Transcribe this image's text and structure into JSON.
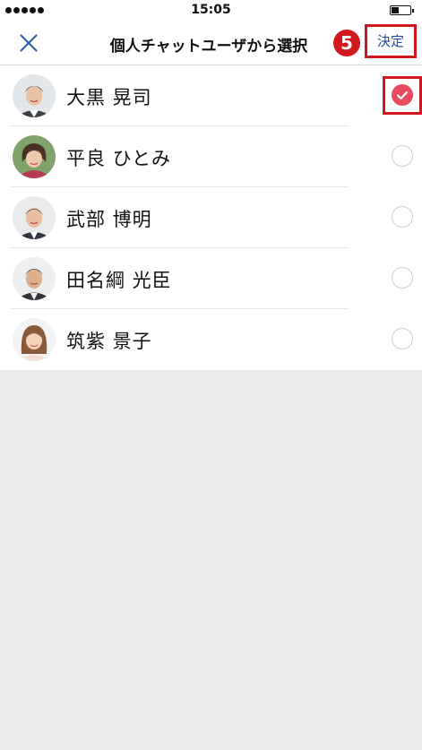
{
  "status_bar": {
    "time": "15:05",
    "battery_level": 0.35
  },
  "navbar": {
    "title": "個人チャットユーザから選択",
    "step_number": "5",
    "confirm_label": "決定",
    "close_icon": "close-x-icon",
    "accent_color": "#d1181f",
    "link_color": "#1f4da0"
  },
  "users": [
    {
      "name": "大黒 晃司",
      "selected": true
    },
    {
      "name": "平良 ひとみ",
      "selected": false
    },
    {
      "name": "武部 博明",
      "selected": false
    },
    {
      "name": "田名綱 光臣",
      "selected": false
    },
    {
      "name": "筑紫 景子",
      "selected": false
    }
  ],
  "check_color": "#e84a5f"
}
